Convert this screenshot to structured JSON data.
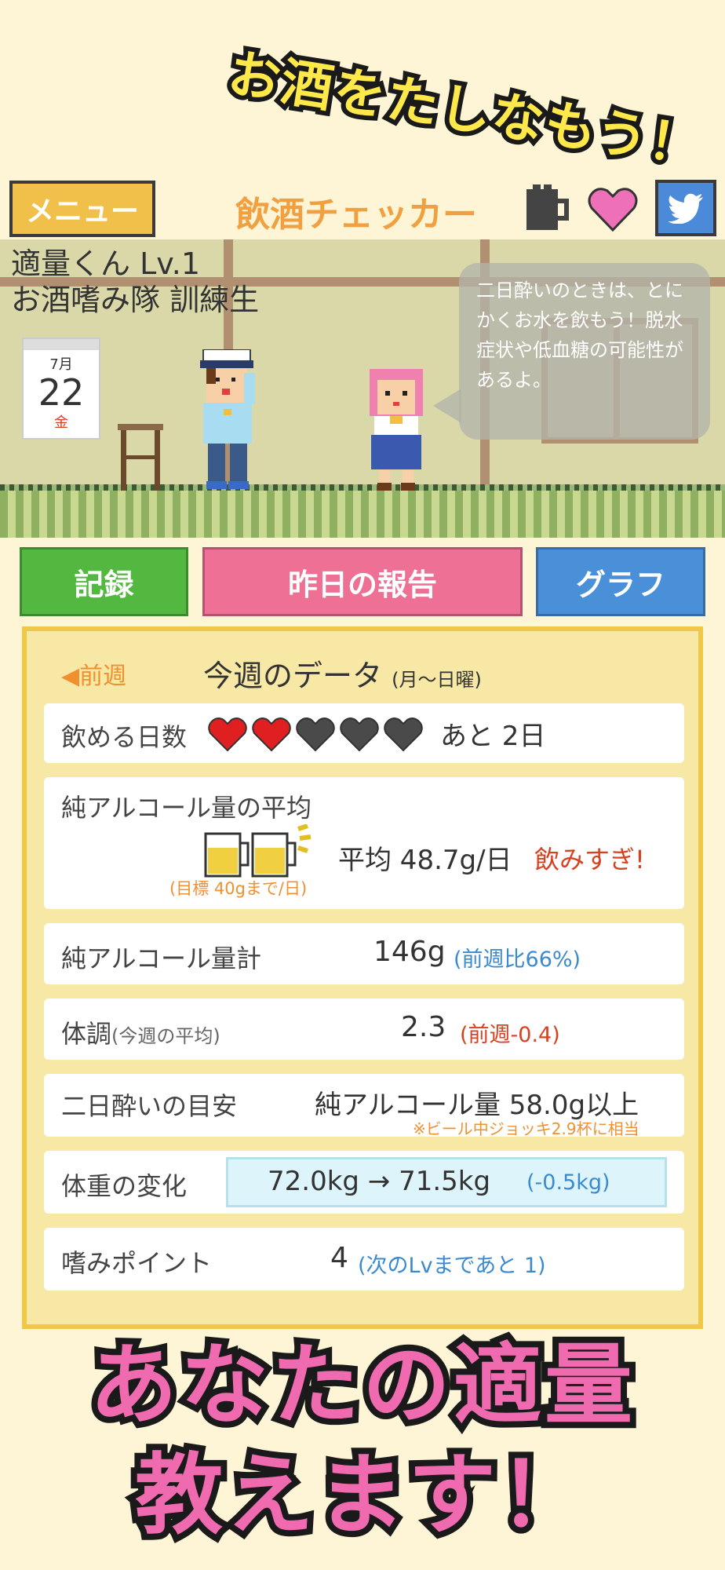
{
  "promo": {
    "top": "お酒をたしなもう！",
    "bottom_line1": "あなたの適量",
    "bottom_line2": "教えます！"
  },
  "header": {
    "menu_label": "メニュー",
    "title": "飲酒チェッカー",
    "icons": [
      "beer-mug-icon",
      "heart-icon",
      "twitter-icon"
    ]
  },
  "scene": {
    "character_name": "適量くん Lv.1",
    "character_rank": "お酒嗜み隊 訓練生",
    "calendar": {
      "month": "7月",
      "day": "22",
      "weekday": "金"
    },
    "speech_bubble": "二日酔いのときは、とにかくお水を飲もう！脱水症状や低血糖の可能性があるよ。"
  },
  "actions": {
    "record": "記録",
    "report": "昨日の報告",
    "graph": "グラフ"
  },
  "week": {
    "prev_label": "◀前週",
    "title": "今週のデータ",
    "range": "(月〜日曜)",
    "drink_days": {
      "label": "飲める日数",
      "hearts_filled": 2,
      "hearts_total": 5,
      "remaining": "あと 2日"
    },
    "avg_alcohol": {
      "label": "純アルコール量の平均",
      "target": "(目標 40gまで/日)",
      "value": "平均 48.7g/日",
      "warning": "飲みすぎ!"
    },
    "total_alcohol": {
      "label": "純アルコール量計",
      "value": "146g",
      "ratio": "(前週比66%)"
    },
    "condition": {
      "label": "体調",
      "sub": "(今週の平均)",
      "value": "2.3",
      "diff": "(前週-0.4)"
    },
    "hangover": {
      "label": "二日酔いの目安",
      "value": "純アルコール量 58.0g以上",
      "note": "※ビール中ジョッキ2.9杯に相当"
    },
    "weight": {
      "label": "体重の変化",
      "value": "72.0kg → 71.5kg",
      "diff": "(-0.5kg)"
    },
    "points": {
      "label": "嗜みポイント",
      "value": "4",
      "next": "(次のLvまであと 1)"
    }
  },
  "colors": {
    "background": "#fdf5d6",
    "accent_orange": "#f09030",
    "record_green": "#52b840",
    "report_pink": "#ee7094",
    "graph_blue": "#4a90d8",
    "heart_red": "#e02020",
    "heart_empty": "#4a4a4a",
    "warning_red": "#d84020",
    "info_blue": "#3a8ad0"
  }
}
